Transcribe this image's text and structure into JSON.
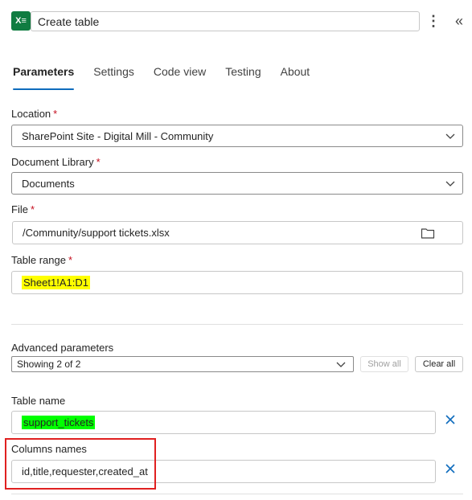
{
  "header": {
    "app_icon": "excel-icon",
    "app_icon_letters": "X≡",
    "title": "Create table",
    "more_icon": "more-vertical-icon",
    "more_glyph": "⋮",
    "collapse_icon": "double-chevron-left-icon",
    "collapse_glyph": "«"
  },
  "tabs": [
    {
      "label": "Parameters",
      "active": true
    },
    {
      "label": "Settings"
    },
    {
      "label": "Code view"
    },
    {
      "label": "Testing"
    },
    {
      "label": "About"
    }
  ],
  "fields": {
    "location": {
      "label": "Location",
      "required": "*",
      "value": "SharePoint Site - Digital Mill - Community"
    },
    "library": {
      "label": "Document Library",
      "required": "*",
      "value": "Documents"
    },
    "file": {
      "label": "File",
      "required": "*",
      "value": "/Community/support tickets.xlsx",
      "icon": "folder-icon"
    },
    "table_range": {
      "label": "Table range",
      "required": "*",
      "value": "Sheet1!A1:D1"
    }
  },
  "advanced": {
    "label": "Advanced parameters",
    "selected": "Showing 2 of 2",
    "show_all": "Show all",
    "clear_all": "Clear all"
  },
  "extra_fields": {
    "table_name": {
      "label": "Table name",
      "value": "support_tickets"
    },
    "columns_names": {
      "label": "Columns names",
      "value": "id,title,requester,created_at"
    }
  },
  "colors": {
    "accent": "#0f6cbd",
    "excel_green": "#107c41",
    "required": "#c50f1f",
    "highlight_yellow": "#ffff00",
    "highlight_green": "#00ff00",
    "annotation_red": "#e02020"
  }
}
